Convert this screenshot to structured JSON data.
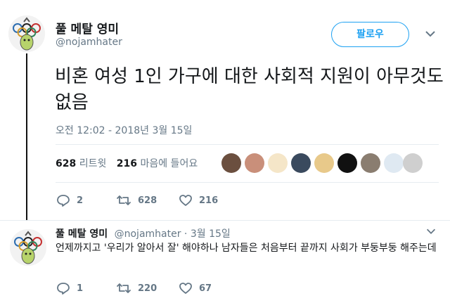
{
  "tweet": {
    "author_name": "풀 메탈 영미",
    "author_handle": "@nojamhater",
    "follow_label": "팔로우",
    "text": "비혼 여성 1인 가구에 대한 사회적 지원이 아무것도 없음",
    "timestamp": "오전 12:02 - 2018년 3월 15일",
    "retweet_count": "628",
    "retweet_label": "리트윗",
    "like_count": "216",
    "like_label": "마음에 들어요",
    "actions": {
      "replies": "2",
      "retweets": "628",
      "likes": "216"
    }
  },
  "reply": {
    "author_name": "풀 메탈 영미",
    "author_handle": "@nojamhater",
    "separator": "·",
    "date": "3월 15일",
    "text": "언제까지고 '우리가 알아서 잘' 해야하나 남자들은 처음부터 끝까지 사회가 부둥부둥 해주는데",
    "actions": {
      "replies": "1",
      "retweets": "220",
      "likes": "67"
    }
  },
  "colors": {
    "accent": "#1da1f2",
    "muted": "#657786",
    "text": "#14171a",
    "divider": "#e6ecf0"
  },
  "icons": [
    "reply-icon",
    "retweet-icon",
    "heart-icon",
    "chevron-down-icon"
  ]
}
